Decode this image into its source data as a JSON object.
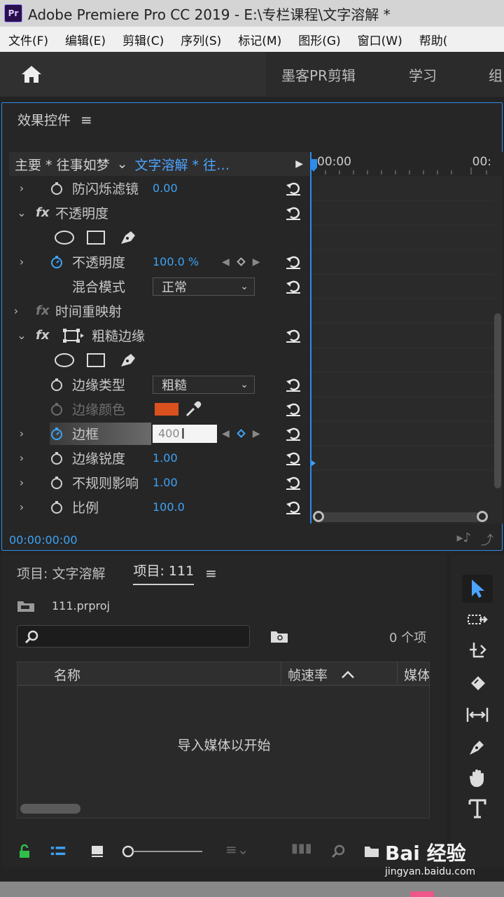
{
  "window": {
    "app_icon": "Pr",
    "title": "Adobe Premiere Pro CC 2019 - E:\\专栏课程\\文字溶解 *"
  },
  "menubar": {
    "items": [
      "文件(F)",
      "编辑(E)",
      "剪辑(C)",
      "序列(S)",
      "标记(M)",
      "图形(G)",
      "窗口(W)",
      "帮助("
    ]
  },
  "workspace": {
    "items": [
      "墨客PR剪辑",
      "学习",
      "组"
    ]
  },
  "effect_controls": {
    "title": "效果控件",
    "clip_master": "主要 * 往事如梦",
    "clip_active": "文字溶解 * 往…",
    "timeline_start": "00:00",
    "timeline_end": "00:",
    "timecode": "00:00:00:00",
    "rows": {
      "anti_flicker": {
        "label": "防闪烁滤镜",
        "value": "0.00"
      },
      "opacity_group": {
        "label": "不透明度"
      },
      "opacity": {
        "label": "不透明度",
        "value": "100.0 %"
      },
      "blend_mode": {
        "label": "混合模式",
        "value": "正常"
      },
      "time_remap": {
        "label": "时间重映射"
      },
      "rough_edges": {
        "label": "粗糙边缘"
      },
      "edge_type": {
        "label": "边缘类型",
        "value": "粗糙"
      },
      "edge_color": {
        "label": "边缘颜色",
        "color": "#d9511f"
      },
      "border": {
        "label": "边框",
        "value": "400"
      },
      "edge_sharpness": {
        "label": "边缘锐度",
        "value": "1.00"
      },
      "irregular": {
        "label": "不规则影响",
        "value": "1.00"
      },
      "scale": {
        "label": "比例",
        "value": "100.0"
      }
    }
  },
  "project": {
    "tab_inactive": "项目: 文字溶解",
    "tab_active": "项目: 111",
    "file": "111.prproj",
    "item_count": "0 个项",
    "columns": [
      "名称",
      "帧速率",
      "媒体"
    ],
    "empty_message": "导入媒体以开始"
  },
  "watermark": {
    "main": "Bai 经验",
    "sub": "jingyan.baidu.com"
  },
  "colors": {
    "accent": "#2d8ceb",
    "value_blue": "#3ea3f5",
    "tool_blue": "#4ca3ff"
  }
}
